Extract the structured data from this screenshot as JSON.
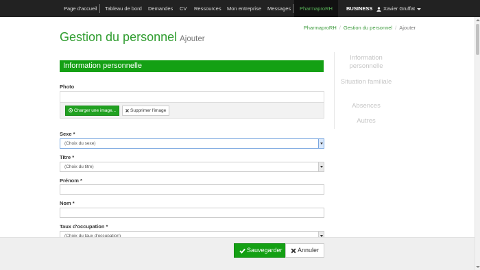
{
  "navbar": {
    "items": [
      "Page d'accueil",
      "Tableau de bord",
      "Demandes",
      "CV",
      "Ressources",
      "Mon entreprise",
      "Messages"
    ],
    "active": "PharmaproRH",
    "business": "BUSINESS",
    "user": "Xavier Gruffat",
    "user_icon": "user-icon",
    "active_color": "#5cb85c"
  },
  "breadcrumb": {
    "items": [
      "PharmaproRH",
      "Gestion du personnel",
      "Ajouter"
    ]
  },
  "page": {
    "title": "Gestion du personnel",
    "subtitle": "Ajouter"
  },
  "section": {
    "header": "Information personnelle",
    "color": "#14a014"
  },
  "side_nav": {
    "items": [
      "Information personnelle",
      "Situation familiale",
      "Absences",
      "Autres"
    ]
  },
  "form": {
    "photo_label": "Photo",
    "upload_button": "Charger une image...",
    "delete_button": "Supprimer l'image",
    "sexe_label": "Sexe *",
    "sexe_value": "(Choix du sexe)",
    "titre_label": "Titre *",
    "titre_value": "(Choix du titre)",
    "prenom_label": "Prénom *",
    "nom_label": "Nom *",
    "taux_label": "Taux d'occupation *",
    "taux_value": "(Choix du taux d'occupation)"
  },
  "actions": {
    "save": "Sauvegarder",
    "cancel": "Annuler"
  }
}
